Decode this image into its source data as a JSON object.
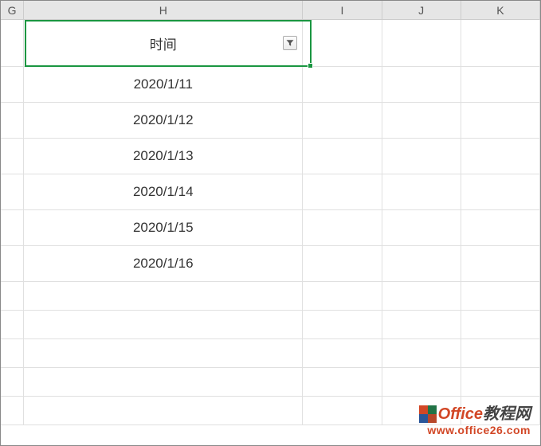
{
  "columns": {
    "g": "G",
    "h": "H",
    "i": "I",
    "j": "J",
    "k": "K"
  },
  "header": {
    "label": "时间"
  },
  "rows": [
    "2020/1/11",
    "2020/1/12",
    "2020/1/13",
    "2020/1/14",
    "2020/1/15",
    "2020/1/16"
  ],
  "watermark": {
    "brand_prefix": "Office",
    "brand_suffix": "教程网",
    "url": "www.office26.com"
  }
}
